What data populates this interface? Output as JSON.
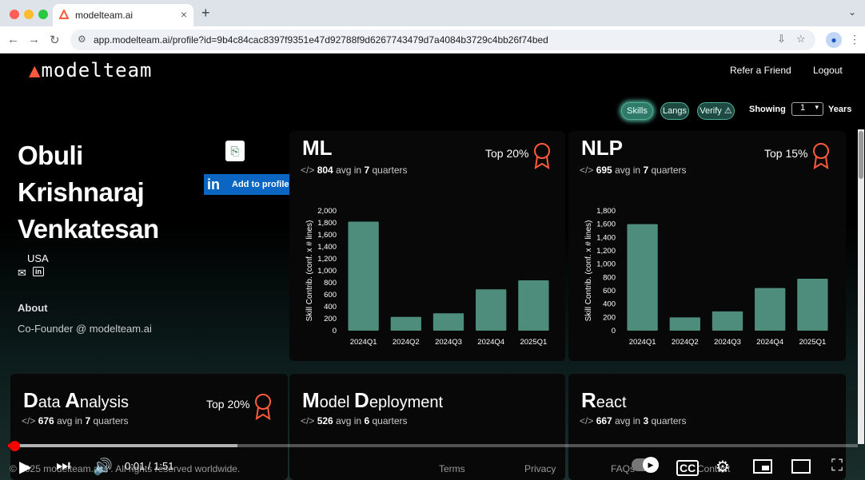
{
  "browser": {
    "tab_title": "modelteam.ai",
    "new_tab": "+",
    "tab_close": "×",
    "url": "app.modelteam.ai/profile?id=9b4c84cac8397f9351e47d92788f9d6267743479d7a4084b3729c4bb26f74bed"
  },
  "header": {
    "logo": "modelteam",
    "refer": "Refer a Friend",
    "logout": "Logout"
  },
  "filters": {
    "skills": "Skills",
    "langs": "Langs",
    "verify": "Verify ⚠",
    "showing": "Showing",
    "years_value": "1",
    "years": "Years"
  },
  "profile": {
    "name_line1": "Obuli",
    "name_line2": "Krishnaraj",
    "name_line3": "Venkatesan",
    "country": "USA",
    "about_label": "About",
    "about_value": "Co-Founder @ modelteam.ai",
    "linkedin_button": "Add to profile",
    "linkedin_logo": "in"
  },
  "skills": [
    {
      "title": "ML",
      "avg": "804",
      "avg_text": "avg in",
      "quarters": "7",
      "quarters_text": "quarters",
      "rank": "Top 20%"
    },
    {
      "title": "NLP",
      "avg": "695",
      "avg_text": "avg in",
      "quarters": "7",
      "quarters_text": "quarters",
      "rank": "Top 15%"
    }
  ],
  "bottom_skills": [
    {
      "title_cap": "D",
      "title_rest": "ata ",
      "title_cap2": "A",
      "title_rest2": "nalysis",
      "avg": "676",
      "avg_text": "avg in",
      "quarters": "7",
      "quarters_text": "quarters",
      "rank": "Top 20%"
    },
    {
      "title_cap": "M",
      "title_rest": "odel ",
      "title_cap2": "D",
      "title_rest2": "eployment",
      "avg": "526",
      "avg_text": "avg in",
      "quarters": "6",
      "quarters_text": "quarters"
    },
    {
      "title_cap": "R",
      "title_rest": "eact",
      "avg": "667",
      "avg_text": "avg in",
      "quarters": "3",
      "quarters_text": "quarters"
    }
  ],
  "chart_data": [
    {
      "type": "bar",
      "categories": [
        "2024Q1",
        "2024Q2",
        "2024Q3",
        "2024Q4",
        "2025Q1"
      ],
      "values": [
        1820,
        230,
        290,
        690,
        840
      ],
      "ylabel": "Skill Contrib. (conf. x # lines)",
      "ylim": [
        0,
        2000
      ],
      "yticks": [
        0,
        200,
        400,
        600,
        800,
        1000,
        1200,
        1400,
        1600,
        1800,
        2000
      ],
      "color": "#4e8d7c"
    },
    {
      "type": "bar",
      "categories": [
        "2024Q1",
        "2024Q2",
        "2024Q3",
        "2024Q4",
        "2025Q1"
      ],
      "values": [
        1600,
        200,
        290,
        640,
        780
      ],
      "ylabel": "Skill Contrib. (conf. x # lines)",
      "ylim": [
        0,
        1800
      ],
      "yticks": [
        0,
        200,
        400,
        600,
        800,
        1000,
        1200,
        1400,
        1600,
        1800
      ],
      "color": "#4e8d7c"
    }
  ],
  "player": {
    "time": "0:01 / 1:51",
    "progress": 0.005,
    "buffered": 0.27
  },
  "footer": {
    "copyright": "© 2025 modelteam.ai™. All rights reserved worldwide.",
    "terms": "Terms",
    "privacy": "Privacy",
    "faqs": "FAQs",
    "contact": "Contact"
  },
  "colors": {
    "accent": "#4fb096",
    "brand": "#ff5a3c",
    "bar": "#4e8d7c"
  }
}
